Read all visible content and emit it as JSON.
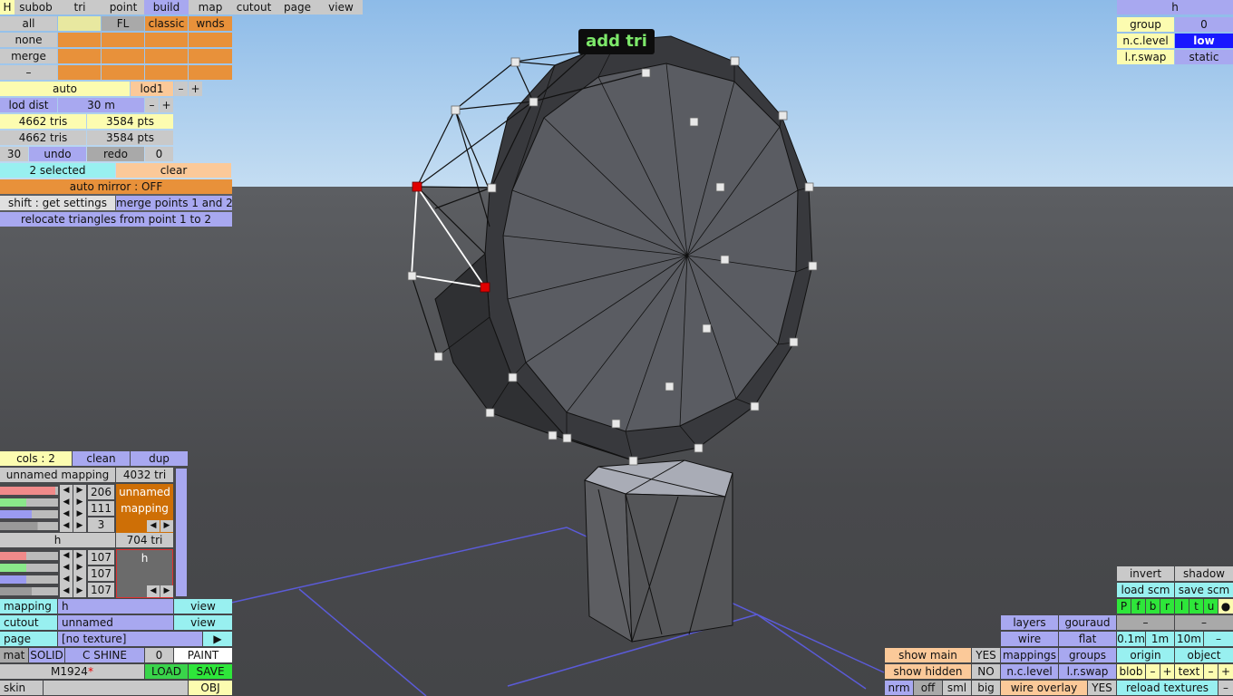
{
  "top_tabs": [
    "H",
    "subob",
    "tri",
    "point",
    "build",
    "map",
    "cutout",
    "page",
    "view"
  ],
  "subobj": {
    "all": "all",
    "none": "none",
    "merge": "merge",
    "minus": "–",
    "fl": "FL",
    "classic": "classic",
    "wnds": "wnds"
  },
  "lod": {
    "auto": "auto",
    "lod1": "lod1",
    "minus": "–",
    "plus": "+",
    "lod_dist": "lod dist",
    "dist_val": "30 m"
  },
  "stats": {
    "tris1": "4662 tris",
    "pts1": "3584 pts",
    "tris2": "4662 tris",
    "pts2": "3584 pts"
  },
  "undo": {
    "count": "30",
    "undo": "undo",
    "redo": "redo",
    "redo_count": "0"
  },
  "selection": {
    "selected": "2 selected",
    "clear": "clear",
    "auto_mirror": "auto mirror : OFF",
    "shift_get": "shift : get settings",
    "merge_points": "merge points 1 and 2",
    "relocate": "relocate triangles from point 1 to 2"
  },
  "tooltip": "add tri",
  "right_top": {
    "name": "h",
    "group_label": "group",
    "group_val": "0",
    "nclevel_label": "n.c.level",
    "nclevel_val": "low",
    "lrswap_label": "l.r.swap",
    "lrswap_val": "static"
  },
  "cols": {
    "cols": "cols : 2",
    "clean": "clean",
    "dup": "dup"
  },
  "mapping1": {
    "name": "unnamed mapping",
    "tris": "4032 tri",
    "v1": "206",
    "v2": "111",
    "v3": "3",
    "swatch": "unnamed mapping",
    "s1": 0.95,
    "s2": 0.45,
    "s3": 0.55,
    "s4": 0.65
  },
  "mapping2": {
    "name": "h",
    "tris": "704 tri",
    "v1": "107",
    "v2": "107",
    "v3": "107",
    "swatch": "h",
    "s1": 0.45,
    "s2": 0.45,
    "s3": 0.45,
    "s4": 0.55
  },
  "mat_rows": {
    "mapping_label": "mapping",
    "mapping_val": "h",
    "view1": "view",
    "cutout_label": "cutout",
    "cutout_val": "unnamed",
    "view2": "view",
    "page_label": "page",
    "page_val": "[no texture]",
    "play": "▶"
  },
  "mat": {
    "mat": "mat",
    "solid": "SOLID",
    "cshine": "C SHINE",
    "zero": "0",
    "paint": "PAINT",
    "m_name": "M1924",
    "star": "*",
    "load": "LOAD",
    "save": "SAVE",
    "skin": "skin",
    "obj": "OBJ"
  },
  "br": {
    "invert": "invert",
    "shadow": "shadow",
    "load_scm": "load scm",
    "save_scm": "save scm",
    "pfbrltu": [
      "P",
      "f",
      "b",
      "r",
      "l",
      "t",
      "u"
    ],
    "dot": "●",
    "layers": "layers",
    "gouraud": "gouraud",
    "minus": "–",
    "wire": "wire",
    "flat": "flat",
    "d01": "0.1m",
    "d1": "1m",
    "d10": "10m",
    "mappings": "mappings",
    "groups": "groups",
    "origin": "origin",
    "object": "object",
    "ncl": "n.c.level",
    "lrs": "l.r.swap",
    "blob": "blob",
    "text": "text",
    "plus": "+",
    "show_main": "show main",
    "yes": "YES",
    "show_hidden": "show hidden",
    "no": "NO",
    "nrm": "nrm",
    "off": "off",
    "sml": "sml",
    "big": "big",
    "wire_overlay": "wire overlay",
    "yes2": "YES",
    "reload": "reload textures"
  },
  "colors": {
    "sky_top": "#8dbbe8",
    "ground": "#4d4e52",
    "selected_point": "#e00000"
  }
}
